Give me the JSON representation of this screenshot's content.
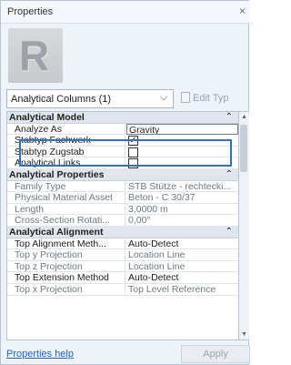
{
  "panel": {
    "title": "Properties",
    "close_glyph": "×"
  },
  "preview": {
    "letter": "R"
  },
  "type_selector": {
    "value": "Analytical Columns (1)",
    "edit_type_label": "Edit Typ"
  },
  "groups": {
    "analytical_model": {
      "label": "Analytical Model",
      "collapse": "⌃"
    },
    "analytical_properties": {
      "label": "Analytical Properties",
      "collapse": "⌃"
    },
    "analytical_alignment": {
      "label": "Analytical Alignment",
      "collapse": "⌃"
    }
  },
  "props": {
    "analyze_as": {
      "name": "Analyze As",
      "value": "Gravity"
    },
    "stabtyp_fachwerk": {
      "name": "Stabtyp Fachwerk",
      "checked": "✓"
    },
    "stabtyp_zugstab": {
      "name": "Stabtyp Zugstab",
      "checked": ""
    },
    "analytical_links": {
      "name": "Analytical Links",
      "checked": ""
    },
    "family_type": {
      "name": "Family Type",
      "value": "STB Stütze - rechtecki..."
    },
    "physical_material": {
      "name": "Physical Material Asset",
      "value": "Beton - C 30/37"
    },
    "length": {
      "name": "Length",
      "value": "3,0000 m"
    },
    "cross_section_rotation": {
      "name": "Cross-Section Rotati...",
      "value": "0,00°"
    },
    "top_alignment_method": {
      "name": "Top Alignment Meth...",
      "value": "Auto-Detect"
    },
    "top_y_projection": {
      "name": "Top y Projection",
      "value": "Location Line"
    },
    "top_z_projection": {
      "name": "Top z Projection",
      "value": "Location Line"
    },
    "top_extension_method": {
      "name": "Top Extension Method",
      "value": "Auto-Detect"
    },
    "top_x_projection": {
      "name": "Top x Projection",
      "value": "Top Level Reference"
    }
  },
  "footer": {
    "help_link": "Properties help",
    "apply_label": "Apply"
  },
  "colors": {
    "highlight": "#2f6fc4",
    "link": "#1a66c6"
  }
}
